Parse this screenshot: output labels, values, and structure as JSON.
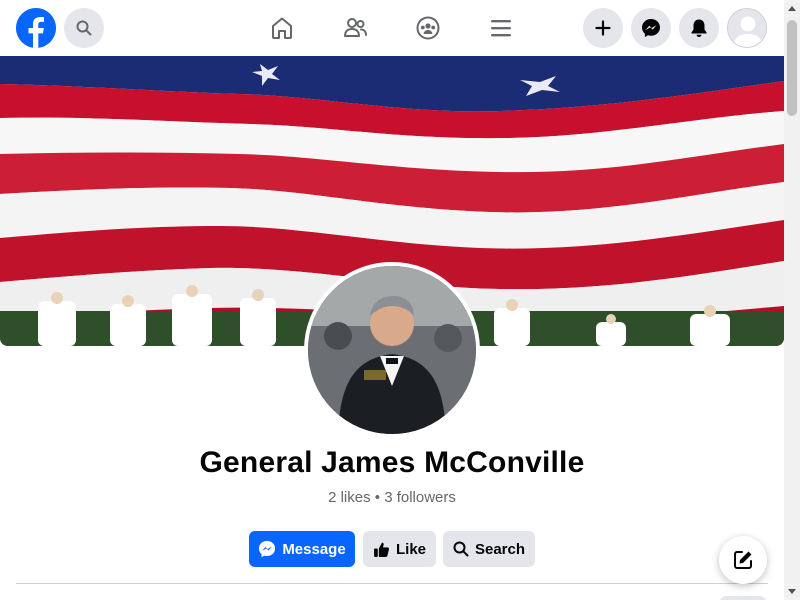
{
  "nav": {
    "logo_icon": "facebook-logo-icon",
    "search_icon": "search-icon",
    "tabs": [
      {
        "icon": "home-icon"
      },
      {
        "icon": "friends-icon"
      },
      {
        "icon": "groups-icon"
      },
      {
        "icon": "menu-icon"
      }
    ],
    "actions": [
      {
        "icon": "plus-icon"
      },
      {
        "icon": "messenger-icon"
      },
      {
        "icon": "bell-icon"
      },
      {
        "icon": "avatar-icon"
      }
    ]
  },
  "profile": {
    "name": "General James McConville",
    "stats": "2 likes • 3 followers"
  },
  "buttons": {
    "message": "Message",
    "like": "Like",
    "search": "Search"
  },
  "colors": {
    "brand": "#0866ff",
    "secondary_button": "#e4e6eb",
    "muted_text": "#65676b"
  }
}
